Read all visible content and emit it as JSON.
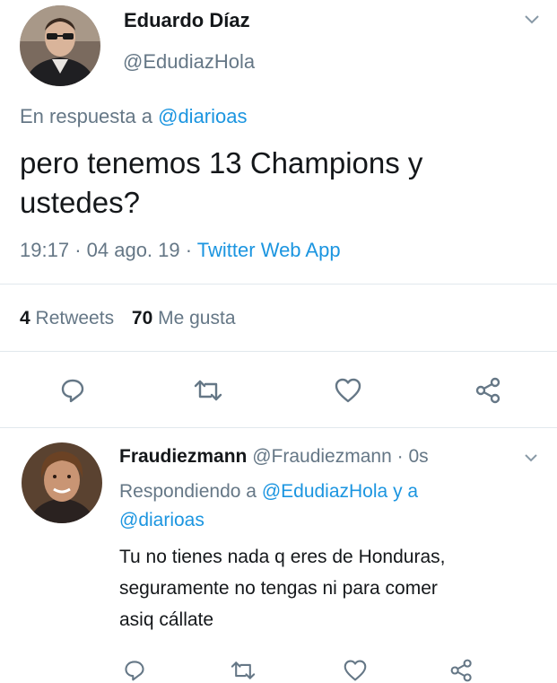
{
  "main_tweet": {
    "display_name": "Eduardo Díaz",
    "handle": "@EdudiazHola",
    "reply_prefix": "En respuesta a",
    "reply_to": "@diarioas",
    "text_line1": "pero tenemos 13 Champions y",
    "text_line2": "ustedes?",
    "time": "19:17",
    "sep1": "·",
    "date": "04 ago. 19",
    "sep2": "·",
    "client": "Twitter Web App",
    "retweets_count": "4",
    "retweets_label": "Retweets",
    "likes_count": "70",
    "likes_label": "Me gusta"
  },
  "reply_tweet": {
    "display_name": "Fraudiezmann",
    "handle": "@Fraudiezmann",
    "time_sep": "·",
    "time": "0s",
    "reply_prefix": "Respondiendo a",
    "reply_to_1": "@EdudiazHola",
    "reply_and": "y a",
    "reply_to_2": "@diarioas",
    "text_line1": "Tu no tienes nada q eres de Honduras,",
    "text_line2": "seguramente no tengas ni para comer",
    "text_line3": "asiq cállate"
  },
  "icons": {
    "reply": "speech-bubble-icon",
    "retweet": "retweet-arrows-icon",
    "like": "heart-icon",
    "share": "share-nodes-icon",
    "menu": "chevron-down-icon"
  },
  "colors": {
    "link": "#1b95e0",
    "secondary": "#657786",
    "text": "#14171a",
    "divider": "#e1e8ed"
  }
}
